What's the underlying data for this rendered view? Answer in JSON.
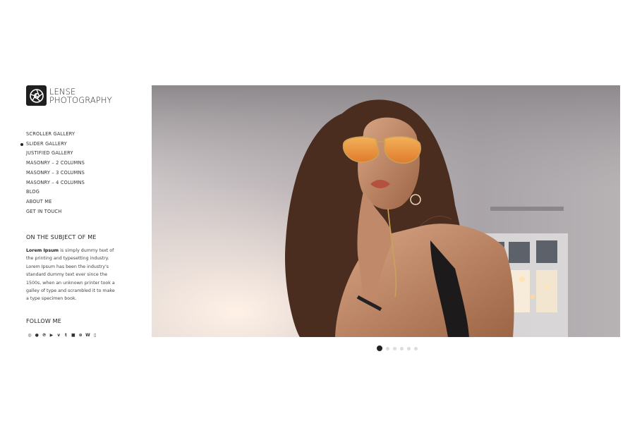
{
  "brand": {
    "line1": "LENSE",
    "line2": "PHOTOGRAPHY"
  },
  "menu": [
    {
      "label": "SCROLLER GALLERY",
      "active": false
    },
    {
      "label": "SLIDER GALLERY",
      "active": true
    },
    {
      "label": "JUSTIFIED GALLERY",
      "active": false
    },
    {
      "label": "MASONRY – 2 COLUMNS",
      "active": false
    },
    {
      "label": "MASONRY – 3 COLUMNS",
      "active": false
    },
    {
      "label": "MASONRY – 4 COLUMNS",
      "active": false
    },
    {
      "label": "BLOG",
      "active": false
    },
    {
      "label": "ABOUT ME",
      "active": false
    },
    {
      "label": "GET IN TOUCH",
      "active": false
    }
  ],
  "about": {
    "title": "ON THE SUBJECT OF ME",
    "bold": "Lorem Ipsum",
    "text": " is simply dummy text of the printing and typesetting industry. Lorem Ipsum has been the industry's standard dummy text ever since the 1500s, when an unknown printer took a galley of type and scrambled it to make a type specimen book."
  },
  "follow": {
    "title": "FOLLOW ME",
    "icons": [
      {
        "name": "instagram-icon",
        "glyph": "◎"
      },
      {
        "name": "github-icon",
        "glyph": "●"
      },
      {
        "name": "pinterest-icon",
        "glyph": "℗"
      },
      {
        "name": "youtube-icon",
        "glyph": "▶"
      },
      {
        "name": "vimeo-icon",
        "glyph": "v"
      },
      {
        "name": "tumblr-icon",
        "glyph": "t"
      },
      {
        "name": "flickr-icon",
        "glyph": "■"
      },
      {
        "name": "dribbble-icon",
        "glyph": "⊛"
      },
      {
        "name": "wordpress-icon",
        "glyph": "W"
      },
      {
        "name": "foursquare-icon",
        "glyph": "▯"
      }
    ]
  },
  "slider": {
    "slide_count": 6,
    "active_index": 0
  }
}
